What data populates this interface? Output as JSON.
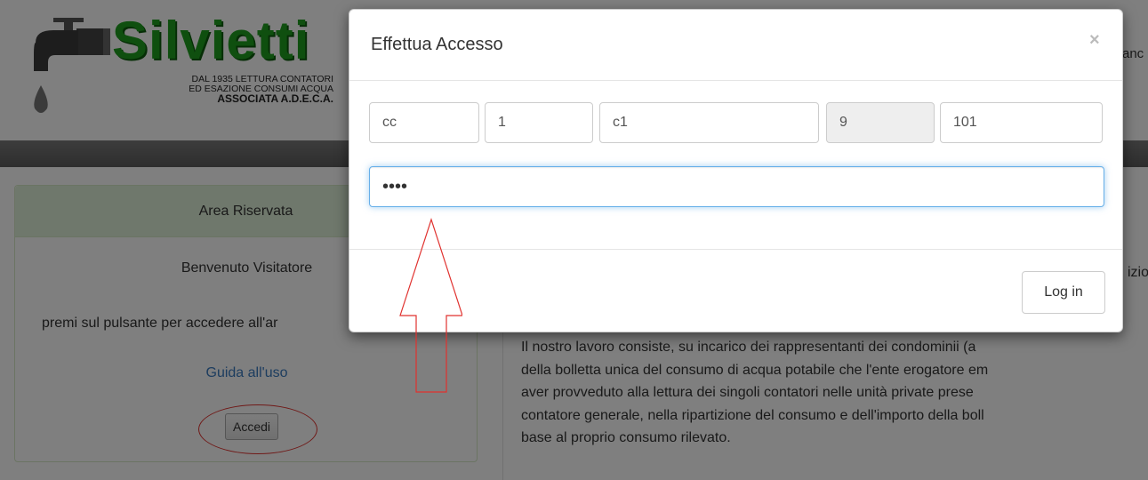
{
  "header": {
    "logo_title": "Silvietti",
    "logo_line1": "DAL 1935 LETTURA CONTATORI",
    "logo_line2": "ED ESAZIONE CONSUMI ACQUA",
    "logo_line3": "ASSOCIATA A.D.E.C.A.",
    "right_fragment": "anc"
  },
  "sidebar": {
    "heading": "Area Riservata",
    "welcome": "Benvenuto Visitatore",
    "instruction": "premi sul pulsante per accedere all'ar",
    "guide_link": "Guida all'uso",
    "accedi_label": "Accedi"
  },
  "main": {
    "tail_fragment": "izio",
    "paragraph_lines": [
      "Il nostro lavoro consiste, su incarico dei rappresentanti dei condominii (a",
      "della bolletta unica del consumo di acqua potabile che l'ente erogatore em",
      "aver provveduto alla lettura dei singoli contatori nelle unità private prese",
      "contatore generale, nella ripartizione del consumo e dell'importo della boll",
      "base al proprio consumo rilevato."
    ]
  },
  "modal": {
    "title": "Effettua Accesso",
    "close_symbol": "×",
    "fields": [
      {
        "value": "cc",
        "readonly": false
      },
      {
        "value": "1",
        "readonly": false
      },
      {
        "value": "c1",
        "readonly": false
      },
      {
        "value": "9",
        "readonly": true
      },
      {
        "value": "101",
        "readonly": false
      }
    ],
    "password_value": "••••",
    "login_label": "Log in"
  },
  "colors": {
    "brand_green": "#1e9e1e",
    "panel_heading_bg": "#dff0d8",
    "link_blue": "#3a7abf",
    "annotation_red": "#e0322f",
    "focus_blue": "#66afe9"
  }
}
